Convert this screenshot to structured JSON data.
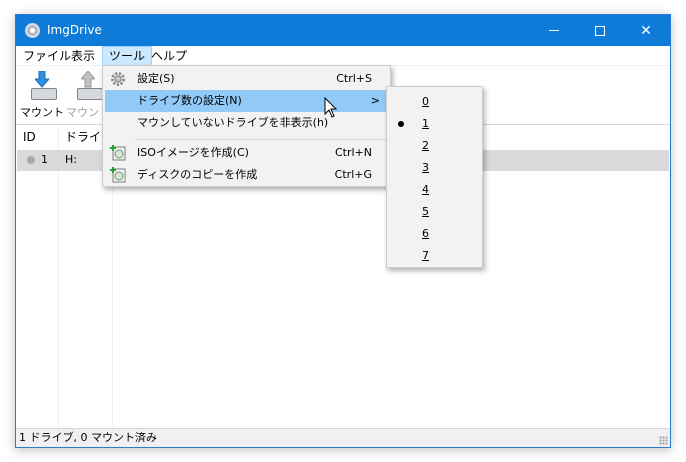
{
  "window": {
    "title": "ImgDrive"
  },
  "menubar": {
    "items": [
      "ファイル",
      "表示",
      "ツール",
      "ヘルプ"
    ]
  },
  "toolbar": {
    "mount_label": "マウント",
    "unmount_label": "マウント"
  },
  "list": {
    "headers": [
      "ID",
      "ドライブ"
    ],
    "rows": [
      {
        "id": "1",
        "drive": "H:"
      }
    ]
  },
  "status": {
    "text": "1 ドライブ, 0 マウント済み"
  },
  "tools_menu": {
    "items": [
      {
        "label": "設定(S)",
        "shortcut": "Ctrl+S"
      },
      {
        "label": "ドライブ数の設定(N)",
        "arrow": ">"
      },
      {
        "label": "マウンしていないドライブを非表示(h)"
      },
      {
        "label": "ISOイメージを作成(C)",
        "shortcut": "Ctrl+N"
      },
      {
        "label": "ディスクのコピーを作成",
        "shortcut": "Ctrl+G"
      }
    ]
  },
  "drive_count_menu": {
    "options": [
      "0",
      "1",
      "2",
      "3",
      "4",
      "5",
      "6",
      "7"
    ],
    "selected": "1"
  },
  "colors": {
    "titlebar": "#0f7bd9",
    "highlight": "#91c9f7",
    "menu_active": "#cce8ff"
  }
}
